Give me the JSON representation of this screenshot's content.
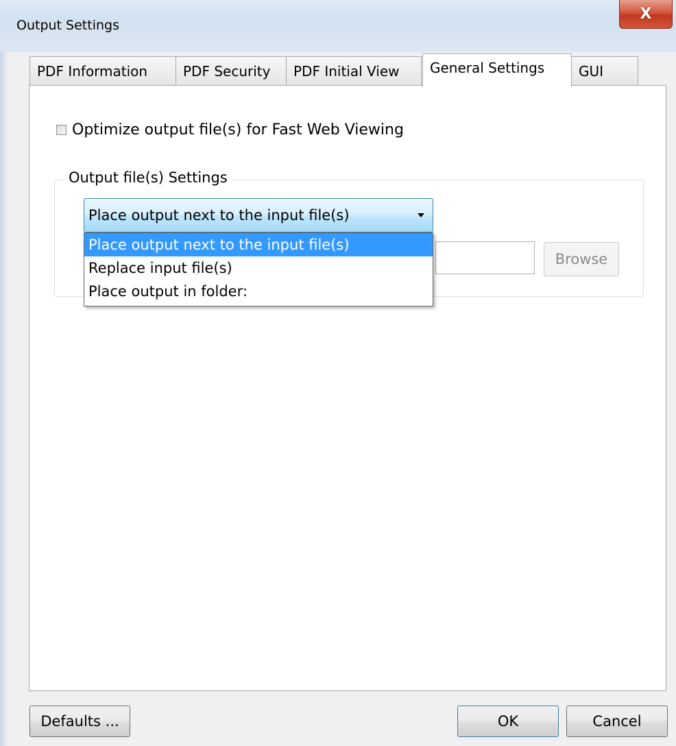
{
  "window": {
    "title": "Output Settings",
    "close_label": "X"
  },
  "tabs": [
    {
      "label": "PDF Information",
      "active": false
    },
    {
      "label": "PDF Security",
      "active": false
    },
    {
      "label": "PDF Initial View",
      "active": false
    },
    {
      "label": "General Settings",
      "active": true
    },
    {
      "label": "GUI",
      "active": false
    }
  ],
  "general": {
    "fast_web_view_label": "Optimize output file(s) for Fast Web Viewing",
    "fast_web_view_checked": false,
    "output_group_title": "Output file(s) Settings",
    "output_mode_selected": "Place output next to the input file(s)",
    "output_mode_options": [
      "Place output next to the input file(s)",
      "Replace input file(s)",
      "Place output in folder:"
    ],
    "folder_path_value": "",
    "browse_label": "Browse"
  },
  "footer": {
    "defaults_label": "Defaults ...",
    "ok_label": "OK",
    "cancel_label": "Cancel"
  },
  "colors": {
    "selection": "#3399ff",
    "close_button": "#c0391f"
  }
}
